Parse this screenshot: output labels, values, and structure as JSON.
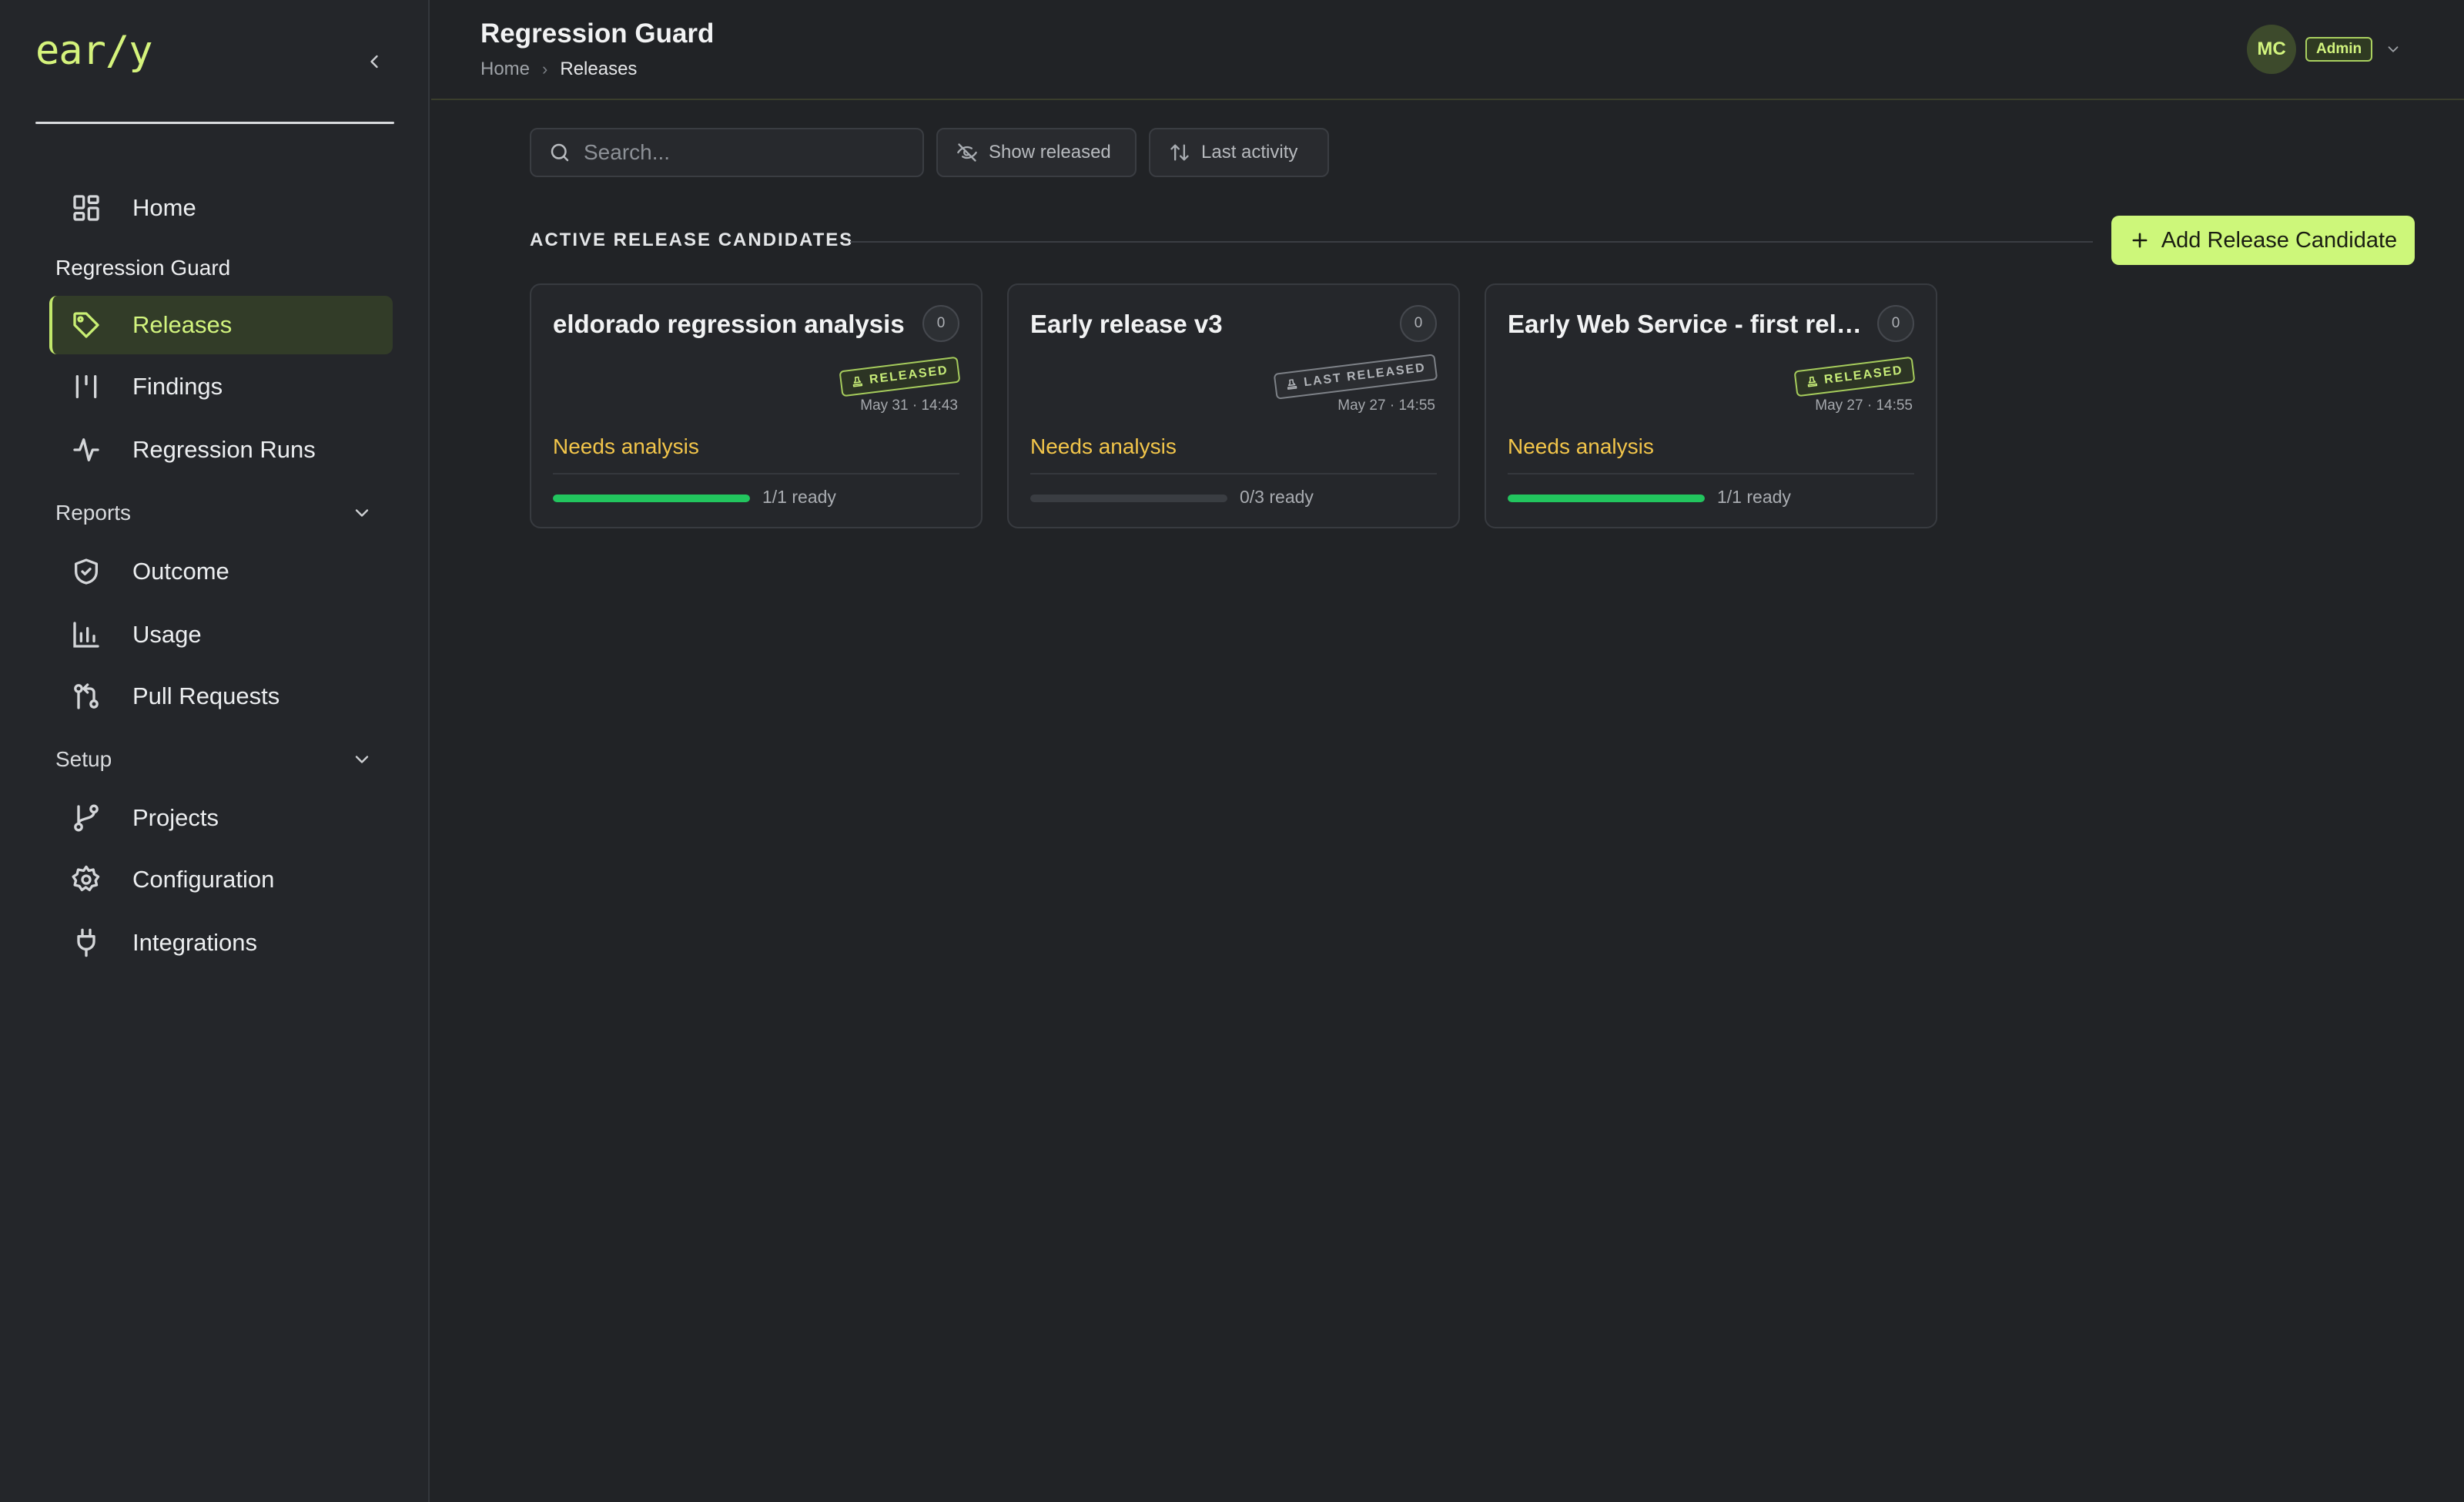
{
  "sidebar": {
    "logo": "ear/y",
    "items": {
      "home": "Home",
      "releases": "Releases",
      "findings": "Findings",
      "regression_runs": "Regression Runs",
      "outcome": "Outcome",
      "usage": "Usage",
      "pull_requests": "Pull Requests",
      "projects": "Projects",
      "configuration": "Configuration",
      "integrations": "Integrations"
    },
    "sections": {
      "regression_guard": "Regression Guard",
      "reports": "Reports",
      "setup": "Setup"
    },
    "active_item": "releases"
  },
  "header": {
    "title": "Regression Guard",
    "breadcrumb": [
      "Home",
      "Releases"
    ],
    "user_initials": "MC",
    "role": "Admin"
  },
  "toolbar": {
    "search_placeholder": "Search...",
    "show_released_label": "Show released",
    "sort_label": "Last activity"
  },
  "section": {
    "heading": "ACTIVE RELEASE CANDIDATES",
    "add_button_label": "Add Release Candidate"
  },
  "cards": [
    {
      "title": "eldorado regression analysis",
      "count": "0",
      "stamp": "RELEASED",
      "stamp_type": "released",
      "date": "May 31 · 14:43",
      "status": "Needs analysis",
      "progress": 1.0,
      "ready": "1/1 ready"
    },
    {
      "title": "Early release v3",
      "count": "0",
      "stamp": "LAST RELEASED",
      "stamp_type": "last",
      "date": "May 27 · 14:55",
      "status": "Needs analysis",
      "progress": 0.0,
      "ready": "0/3 ready"
    },
    {
      "title": "Early Web Service - first release",
      "count": "0",
      "stamp": "RELEASED",
      "stamp_type": "released",
      "date": "May 27 · 14:55",
      "status": "Needs analysis",
      "progress": 1.0,
      "ready": "1/1 ready"
    }
  ],
  "colors": {
    "accent": "#cdf77a",
    "status_warning": "#f2c54a",
    "progress_fill": "#22c55e",
    "background": "#212326"
  },
  "icons": {
    "home": "grid-icon",
    "releases": "tag-icon",
    "findings": "findings-icon",
    "regression_runs": "activity-icon",
    "outcome": "shield-check-icon",
    "usage": "bar-chart-icon",
    "pull_requests": "git-pull-request-icon",
    "projects": "git-branch-icon",
    "configuration": "gear-icon",
    "integrations": "plug-icon"
  }
}
